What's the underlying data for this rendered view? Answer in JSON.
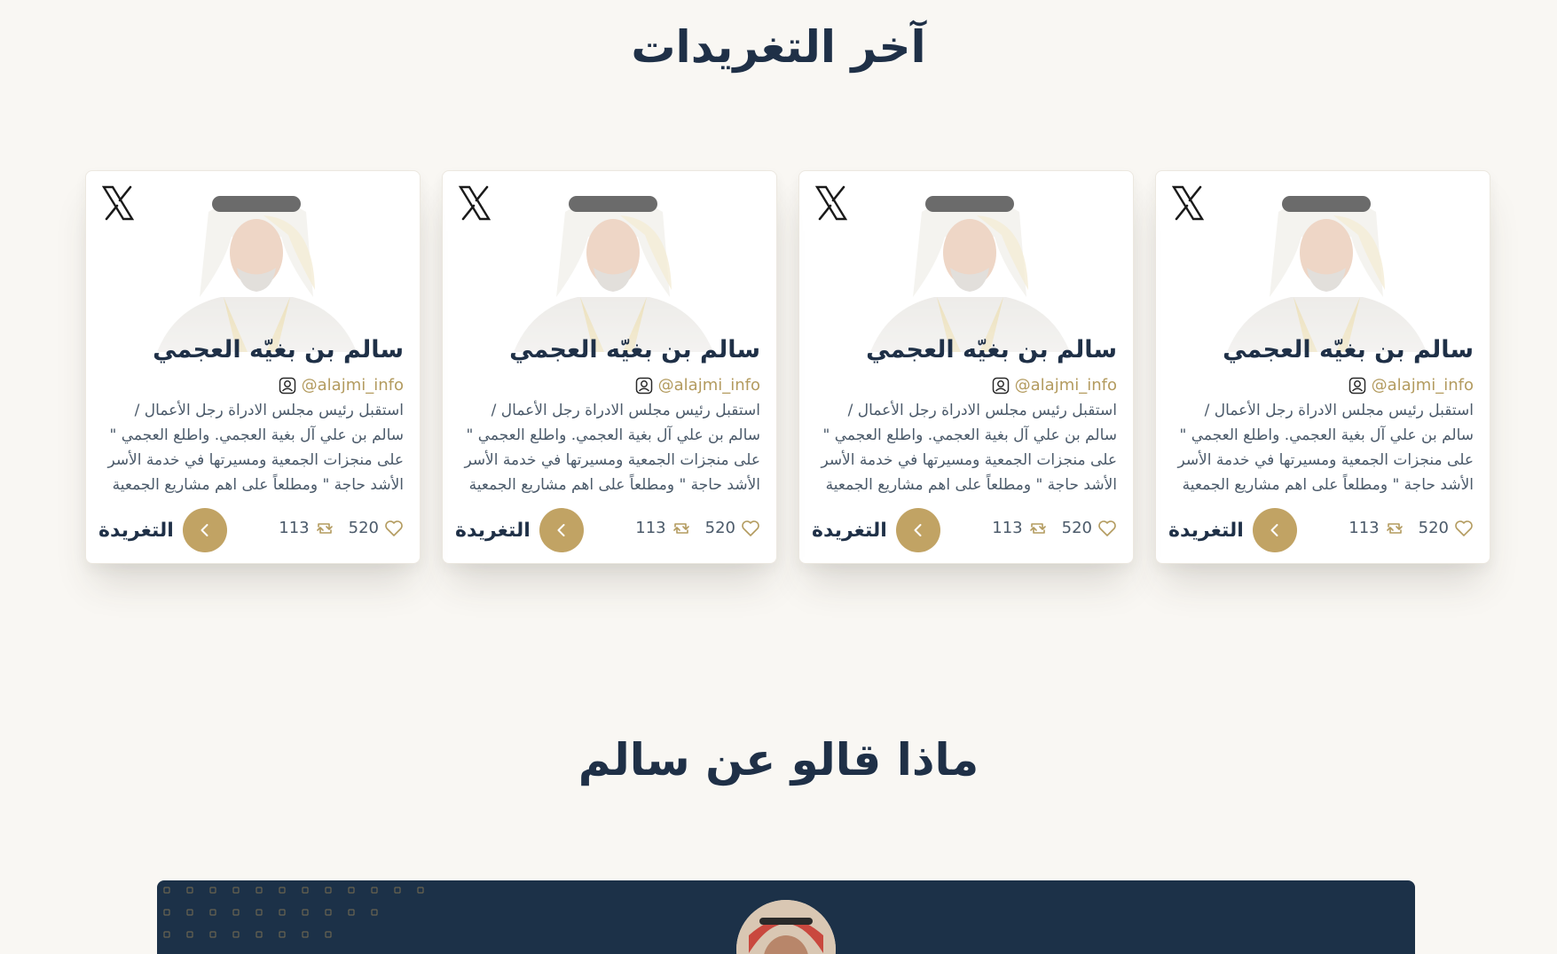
{
  "sections": {
    "tweets_title": "آخر التغريدات",
    "said_title": "ماذا قالو عن سالم"
  },
  "tweets": [
    {
      "name": "سالم بن بغيّه العجمي",
      "handle": "@alajmi_info",
      "text": "استقبل رئيس مجلس الادراة رجل الأعمال / سالم بن علي آل بغية العجمي. واطلع العجمي \" على منجزات الجمعية ومسيرتها في خدمة الأسر الأشد حاجة \" ومطلعاً على اهم مشاريع الجمعية وخا...",
      "likes": "520",
      "retweets": "113",
      "link_label": "التغريدة"
    },
    {
      "name": "سالم بن بغيّه العجمي",
      "handle": "@alajmi_info",
      "text": "استقبل رئيس مجلس الادراة رجل الأعمال / سالم بن علي آل بغية العجمي. واطلع العجمي \" على منجزات الجمعية ومسيرتها في خدمة الأسر الأشد حاجة \" ومطلعاً على اهم مشاريع الجمعية وخا...",
      "likes": "520",
      "retweets": "113",
      "link_label": "التغريدة"
    },
    {
      "name": "سالم بن بغيّه العجمي",
      "handle": "@alajmi_info",
      "text": "استقبل رئيس مجلس الادراة رجل الأعمال / سالم بن علي آل بغية العجمي. واطلع العجمي \" على منجزات الجمعية ومسيرتها في خدمة الأسر الأشد حاجة \" ومطلعاً على اهم مشاريع الجمعية وخا...",
      "likes": "520",
      "retweets": "113",
      "link_label": "التغريدة"
    },
    {
      "name": "سالم بن بغيّه العجمي",
      "handle": "@alajmi_info",
      "text": "استقبل رئيس مجلس الادراة رجل الأعمال / سالم بن علي آل بغية العجمي. واطلع العجمي \" على منجزات الجمعية ومسيرتها في خدمة الأسر الأشد حاجة \" ومطلعاً على اهم مشاريع الجمعية وخا...",
      "likes": "520",
      "retweets": "113",
      "link_label": "التغريدة"
    }
  ],
  "icons": {
    "brand": "x-logo-icon",
    "handle": "user-icon",
    "likes": "heart-icon",
    "retweets": "retweet-icon",
    "link": "chevron-left-icon"
  },
  "colors": {
    "background": "#f9f7f3",
    "navy": "#1c3148",
    "gold": "#c1a364",
    "handle_gold": "#b39b5f",
    "text": "#4b5a6a"
  }
}
